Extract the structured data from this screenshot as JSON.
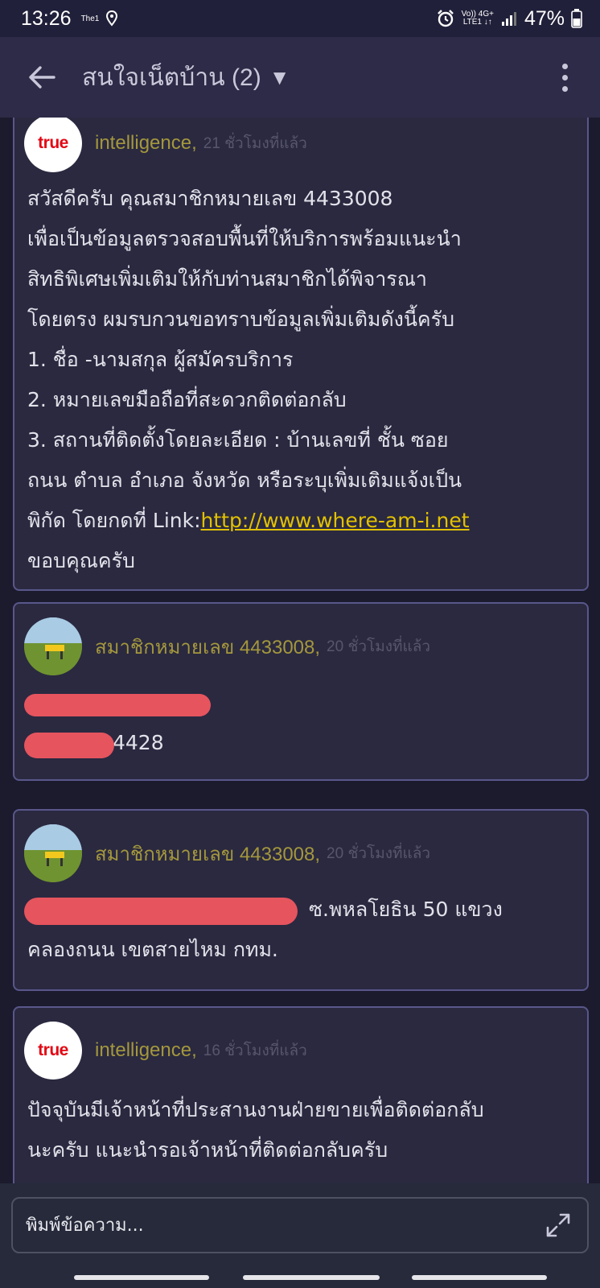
{
  "status_bar": {
    "time": "13:26",
    "carrier_mini": "The1",
    "network_top": "Vo)) 4G+",
    "network_bottom": "LTE1 ↓↑",
    "battery": "47%"
  },
  "app_bar": {
    "title": "สนใจเน็ตบ้าน (2)",
    "dropdown_glyph": "▼",
    "back_icon": "arrow-left-icon",
    "menu_icon": "more-vertical-icon"
  },
  "messages": [
    {
      "avatar_logo": "true",
      "author": "intelligence,",
      "time": "21 ชั่วโมงที่แล้ว",
      "lines": [
        "สวัสดีครับ คุณสมาชิกหมายเลข 4433008",
        "เพื่อเป็นข้อมูลตรวจสอบพื้นที่ให้บริการพร้อมแนะนำ",
        "สิทธิพิเศษเพิ่มเติมให้กับท่านสมาชิกได้พิจารณา",
        "โดยตรง ผมรบกวนขอทราบข้อมูลเพิ่มเติมดังนี้ครับ",
        "1. ชื่อ -นามสกุล ผู้สมัครบริการ",
        "2. หมายเลขมือถือที่สะดวกติดต่อกลับ",
        "3. สถานที่ติดตั้งโดยละเอียด : บ้านเลขที่ ชั้น ซอย",
        "ถนน ตำบล อำเภอ จังหวัด หรือระบุเพิ่มเติมแจ้งเป็น"
      ],
      "link_prefix": "พิกัด โดยกดที่ Link:",
      "link": "http://www.where-am-i.net",
      "closing": "ขอบคุณครับ"
    },
    {
      "author": "สมาชิกหมายเลข 4433008,",
      "time": "20 ชั่วโมงที่แล้ว",
      "visible_text": "4428"
    },
    {
      "author": "สมาชิกหมายเลข 4433008,",
      "time": "20 ชั่วโมงที่แล้ว",
      "line1_visible": "ซ.พหลโยธิน 50 แขวง",
      "line2": "คลองถนน เขตสายไหม กทม."
    },
    {
      "avatar_logo": "true",
      "author": "intelligence,",
      "time": "16 ชั่วโมงที่แล้ว",
      "lines": [
        "ปัจจุบันมีเจ้าหน้าที่ประสานงานฝ่ายขายเพื่อติดต่อกลับ",
        "นะครับ แนะนำรอเจ้าหน้าที่ติดต่อกลับครับ"
      ]
    }
  ],
  "composer": {
    "placeholder": "พิมพ์ข้อความ...",
    "expand_icon": "expand-icon"
  },
  "colors": {
    "background": "#1c1b2e",
    "card": "#2a2940",
    "card_border": "#59578a",
    "author": "#a4973c",
    "link": "#e2c100",
    "redaction": "#e6545e"
  }
}
